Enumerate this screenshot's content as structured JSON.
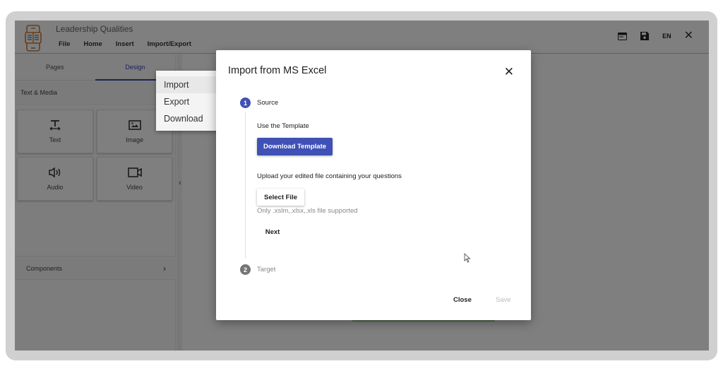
{
  "app": {
    "title": "Leadership Qualities",
    "menu": [
      "File",
      "Home",
      "Insert",
      "Import/Export"
    ],
    "header_icons": [
      "preview-icon",
      "save-icon"
    ],
    "language": "EN",
    "close_icon": "✕"
  },
  "sidebar": {
    "tabs": [
      {
        "label": "Pages",
        "active": false
      },
      {
        "label": "Design",
        "active": true
      }
    ],
    "section_title": "Text & Media",
    "tiles": [
      {
        "label": "Text",
        "icon": "text-icon"
      },
      {
        "label": "Image",
        "icon": "image-icon"
      },
      {
        "label": "Audio",
        "icon": "audio-icon"
      },
      {
        "label": "Video",
        "icon": "video-icon"
      }
    ],
    "components_label": "Components",
    "components_chevron": "›",
    "collapse_glyph": "‹"
  },
  "dropdown": {
    "items": [
      {
        "label": "Import",
        "arrow": "▶"
      },
      {
        "label": "Export",
        "arrow": "▶"
      },
      {
        "label": "Download",
        "arrow": "▶"
      }
    ]
  },
  "modal": {
    "title": "Import from MS Excel",
    "close": "✕",
    "steps": [
      {
        "number": "1",
        "label": "Source"
      },
      {
        "number": "2",
        "label": "Target"
      }
    ],
    "use_template": "Use the Template",
    "download_button": "Download Template",
    "upload_text": "Upload your edited file containing your questions",
    "select_file_button": "Select File",
    "supported_text": "Only .xslm,.xlsx,.xls file supported",
    "next_button": "Next",
    "close_button": "Close",
    "save_button": "Save"
  },
  "colors": {
    "accent": "#3f51b5",
    "logo": "#d07a2a",
    "step_inactive": "#757575"
  }
}
